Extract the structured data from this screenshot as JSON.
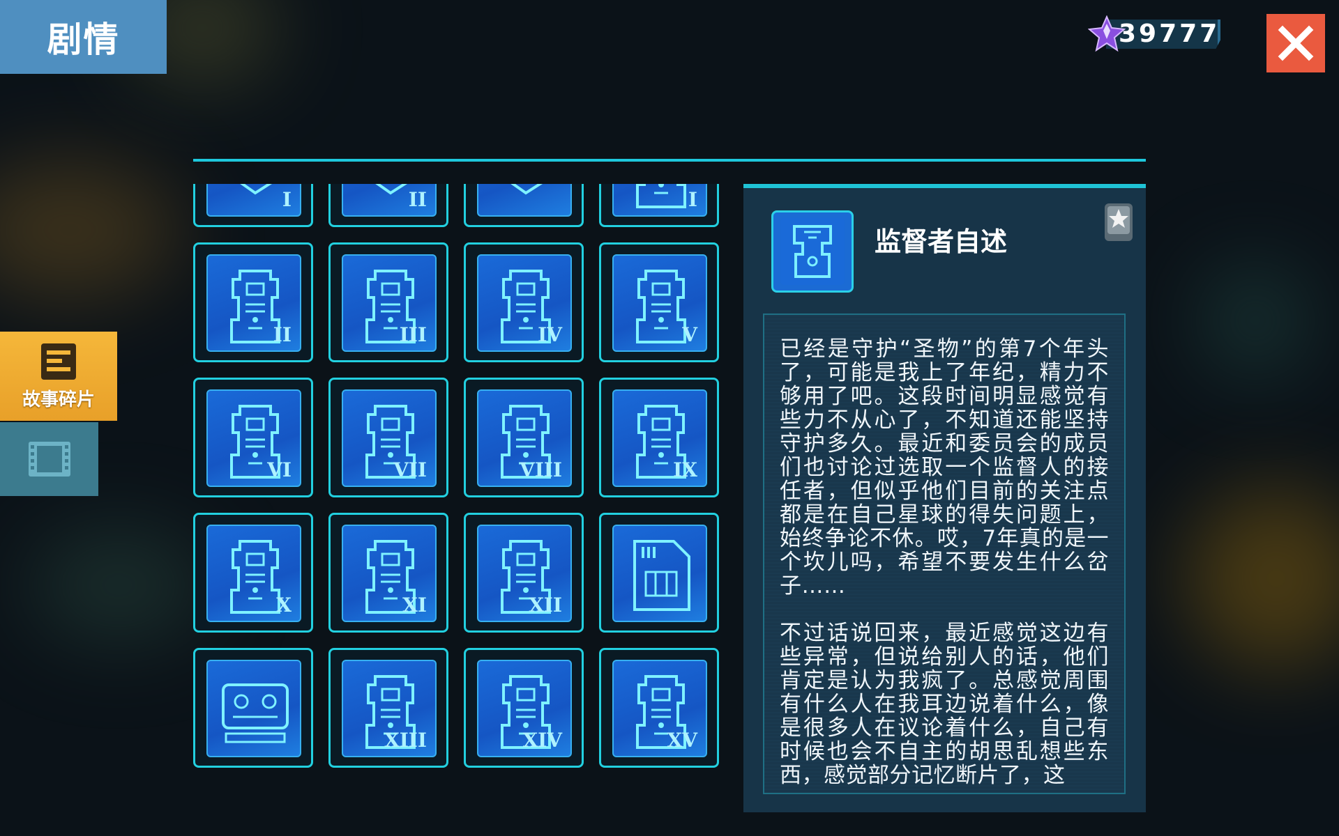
{
  "header": {
    "title": "剧情"
  },
  "currency": {
    "value": "39777",
    "icon": "crystal-gem-icon"
  },
  "close": {
    "icon": "close-icon"
  },
  "sidebar": {
    "tabs": [
      {
        "label": "故事碎片",
        "icon": "fragment-icon",
        "active": true
      },
      {
        "label": "",
        "icon": "film-icon",
        "active": false
      }
    ]
  },
  "grid": {
    "cards": [
      {
        "type": "document",
        "numeral": "I"
      },
      {
        "type": "document",
        "numeral": "II"
      },
      {
        "type": "document",
        "numeral": ""
      },
      {
        "type": "robot",
        "numeral": "I"
      },
      {
        "type": "robot",
        "numeral": "II"
      },
      {
        "type": "robot",
        "numeral": "III"
      },
      {
        "type": "robot",
        "numeral": "IV"
      },
      {
        "type": "robot",
        "numeral": "V"
      },
      {
        "type": "robot",
        "numeral": "VI"
      },
      {
        "type": "robot",
        "numeral": "VII"
      },
      {
        "type": "robot",
        "numeral": "VIII"
      },
      {
        "type": "robot",
        "numeral": "IX"
      },
      {
        "type": "robot",
        "numeral": "X"
      },
      {
        "type": "robot",
        "numeral": "XI"
      },
      {
        "type": "robot",
        "numeral": "XII"
      },
      {
        "type": "chip",
        "numeral": ""
      },
      {
        "type": "device",
        "numeral": ""
      },
      {
        "type": "robot",
        "numeral": "XIII"
      },
      {
        "type": "robot",
        "numeral": "XIV"
      },
      {
        "type": "robot",
        "numeral": "XV"
      }
    ]
  },
  "detail": {
    "title": "监督者自述",
    "icon": "circuit-tower-icon",
    "rarity_icon": "silver-star-badge-icon",
    "paragraph1": "已经是守护“圣物”的第7个年头了，可能是我上了年纪，精力不够用了吧。这段时间明显感觉有些力不从心了，不知道还能坚持守护多久。最近和委员会的成员们也讨论过选取一个监督人的接任者，但似乎他们目前的关注点都是在自己星球的得失问题上，始终争论不休。哎，7年真的是一个坎儿吗，希望不要发生什么岔子……",
    "paragraph2": "不过话说回来，最近感觉这边有些异常，但说给别人的话，他们肯定是认为我疯了。总感觉周围有什么人在我耳边说着什么，像是很多人在议论着什么，自己有时候也会不自主的胡思乱想些东西，感觉部分记忆断片了，这"
  }
}
